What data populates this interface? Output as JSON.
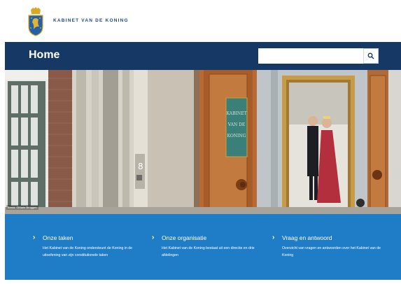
{
  "header": {
    "site_name": "KABINET VAN DE KONING",
    "logo_icon": "royal-crest-icon"
  },
  "nav": {
    "title": "Home",
    "search": {
      "placeholder": "",
      "value": "",
      "button_icon": "search-icon"
    }
  },
  "hero": {
    "photo_credit": "Beeld: ©Marie Bruggen",
    "door_sign": [
      "KABINET",
      "VAN DE",
      "KONING"
    ],
    "door_number": "8"
  },
  "links": [
    {
      "icon": "chevron-right-icon",
      "title": "Onze taken",
      "description": "Het Kabinet van de Koning ondersteunt de Koning in de uitoefening van zijn constitutionele taken"
    },
    {
      "icon": "chevron-right-icon",
      "title": "Onze organisatie",
      "description": "Het Kabinet van de Koning bestaat uit een directie en drie afdelingen"
    },
    {
      "icon": "chevron-right-icon",
      "title": "Vraag en antwoord",
      "description": "Overzicht van vragen en antwoorden over het Kabinet van de Koning"
    }
  ],
  "colors": {
    "navbar": "#153964",
    "panel": "#1f7dc8",
    "brand_text": "#1b4a87"
  }
}
